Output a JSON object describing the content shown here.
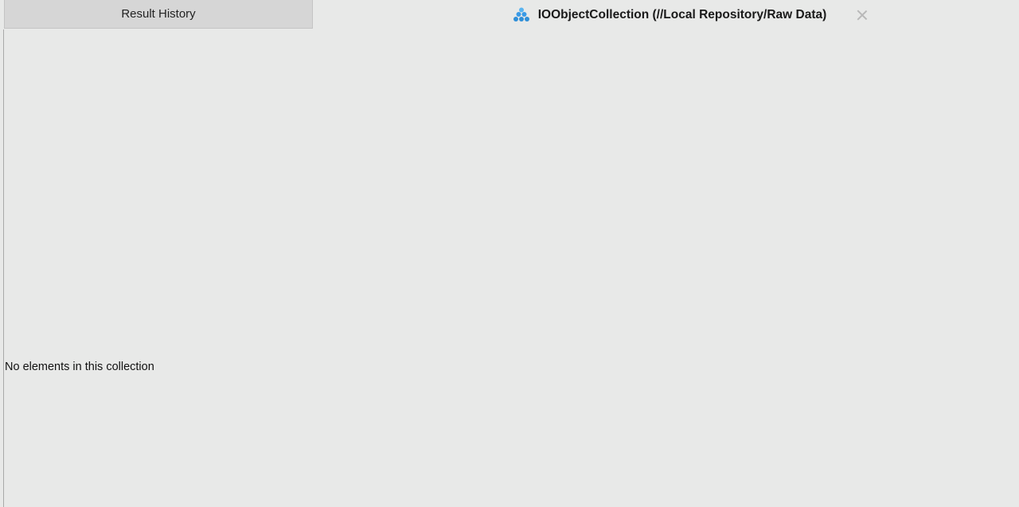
{
  "tabs": {
    "history_label": "Result History",
    "active_label": "IOObjectCollection (//Local Repository/Raw Data)",
    "active_icon": "collection-icon",
    "close_icon": "close-icon"
  },
  "content": {
    "empty_message": "No elements in this collection"
  },
  "colors": {
    "background": "#e8e9e8",
    "inactive_tab": "#d6d6d6",
    "icon_blue": "#2f8fd8"
  }
}
